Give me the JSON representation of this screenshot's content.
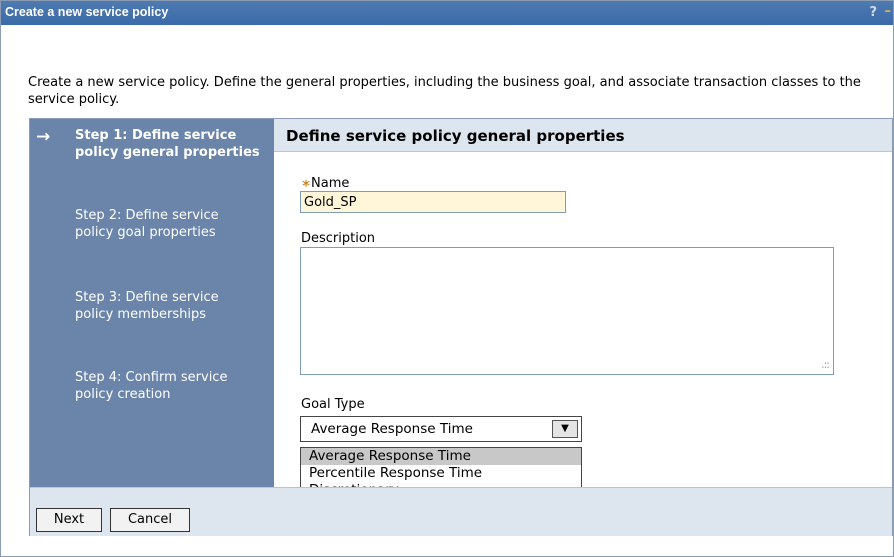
{
  "window": {
    "title": "Create a new service policy",
    "help_label": "?",
    "minimize_label": "–"
  },
  "intro": "Create a new service policy. Define the general properties, including the business goal, and associate transaction classes to the service policy.",
  "steps": [
    {
      "label": "Step 1: Define service policy general properties",
      "active": true
    },
    {
      "label": "Step 2: Define service policy goal properties",
      "active": false
    },
    {
      "label": "Step 3: Define service policy memberships",
      "active": false
    },
    {
      "label": "Step 4: Confirm service policy creation",
      "active": false
    }
  ],
  "current_arrow": "→",
  "content": {
    "header": "Define service policy general properties",
    "required_mark": "∗",
    "name_label": "Name",
    "name_value": "Gold_SP",
    "description_label": "Description",
    "description_value": "",
    "goal_type_label": "Goal Type",
    "goal_type_selected": "Average Response Time",
    "goal_type_options": [
      "Average Response Time",
      "Percentile Response Time",
      "Discretionary"
    ]
  },
  "buttons": {
    "next": "Next",
    "cancel": "Cancel"
  }
}
